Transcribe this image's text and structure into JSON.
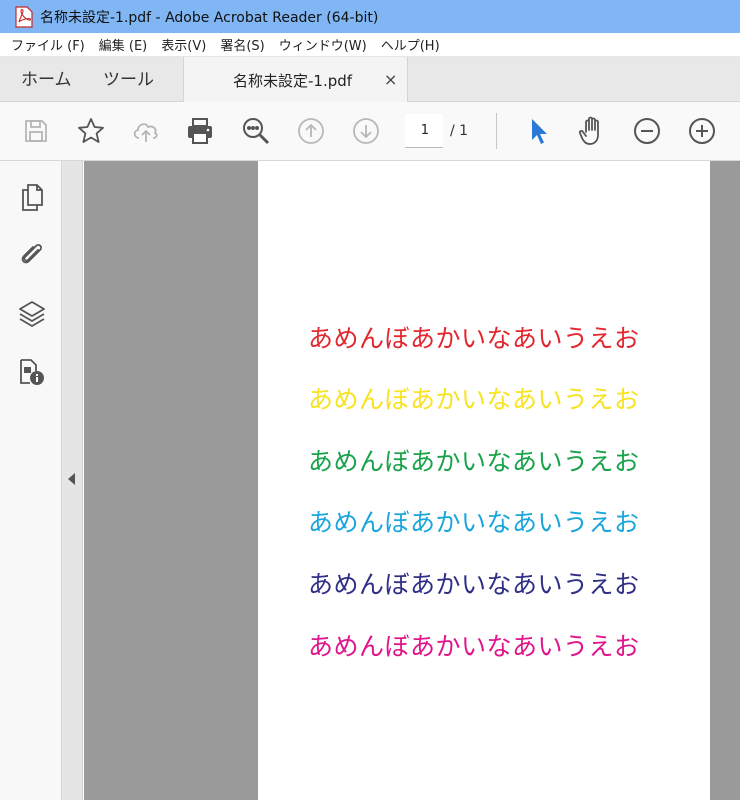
{
  "window": {
    "title": "名称未設定-1.pdf - Adobe Acrobat Reader (64-bit)"
  },
  "menu": {
    "items": [
      {
        "label": "ファイル (F)"
      },
      {
        "label": "編集 (E)"
      },
      {
        "label": "表示(V)"
      },
      {
        "label": "署名(S)"
      },
      {
        "label": "ウィンドウ(W)"
      },
      {
        "label": "ヘルプ(H)"
      }
    ]
  },
  "tabs": {
    "home": "ホーム",
    "tools": "ツール",
    "document": "名称未設定-1.pdf",
    "close": "×"
  },
  "toolbar": {
    "icons": [
      "save-icon",
      "star-icon",
      "cloud-upload-icon",
      "print-icon",
      "zoom-search-icon",
      "page-up-icon",
      "page-down-icon",
      "select-cursor-icon",
      "hand-icon",
      "zoom-out-icon",
      "zoom-in-icon"
    ],
    "page_current": "1",
    "page_total": "/ 1"
  },
  "sidebar": {
    "icons": [
      "pages-icon",
      "attachment-icon",
      "layers-icon",
      "document-info-icon"
    ]
  },
  "colors": {
    "accent_blue": "#2a79d6",
    "titlebar": "#7fb6f3",
    "canvas_gray": "#9a9a9a"
  },
  "document": {
    "lines": [
      {
        "text": "あめんぼあかいなあいうえお",
        "color": "#e2272f"
      },
      {
        "text": "あめんぼあかいなあいうえお",
        "color": "#f7e322"
      },
      {
        "text": "あめんぼあかいなあいうえお",
        "color": "#18a34a"
      },
      {
        "text": "あめんぼあかいなあいうえお",
        "color": "#1aa6dc"
      },
      {
        "text": "あめんぼあかいなあいうえお",
        "color": "#2f2f86"
      },
      {
        "text": "あめんぼあかいなあいうえお",
        "color": "#e0158b"
      }
    ]
  }
}
